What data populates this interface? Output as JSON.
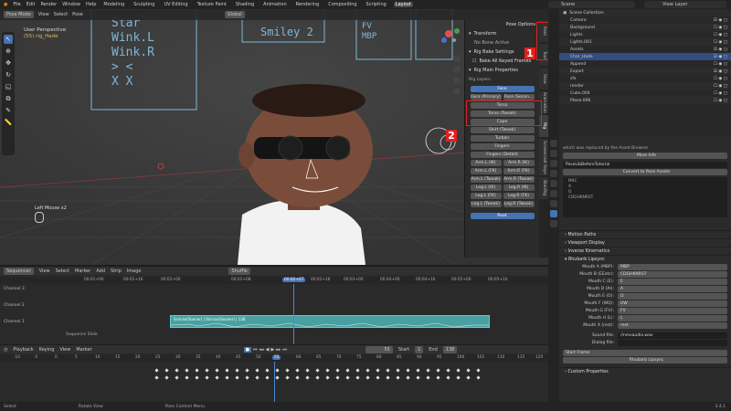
{
  "topbar": {
    "menus": [
      "File",
      "Edit",
      "Render",
      "Window",
      "Help"
    ],
    "workspaces": [
      "Layout",
      "Modeling",
      "Sculpting",
      "UV Editing",
      "Texture Paint",
      "Shading",
      "Animation",
      "Rendering",
      "Compositing",
      "Scripting",
      "Layout"
    ],
    "active_workspace_index": 10,
    "scene": "Scene",
    "view_layer": "View Layer"
  },
  "viewport": {
    "mode": "Pose Mode",
    "menus": [
      "View",
      "Select",
      "Pose"
    ],
    "orientation": "Global",
    "info_line1": "User Perspective",
    "info_line2": "(55) rig_Hade",
    "hotkey_hint": "Left Mouse x2",
    "board_text_left": [
      "Star",
      "Wink.L",
      "Wink.R",
      "> <",
      "X X"
    ],
    "board_text_mid": "Smiley 2",
    "board_text_right": [
      "FV",
      "MBP"
    ]
  },
  "npanel": {
    "options_label": "Pose Options",
    "transform": "Transform",
    "bone_active": "No Bone Active",
    "bake_title": "Rig Bake Settings",
    "bake_btn": "Bake All Keyed Frames",
    "main_props": "Rig Main Properties",
    "layers_label": "Rig Layers",
    "buttons": [
      {
        "label": "Face",
        "style": "blue"
      },
      {
        "label": "Face (Primary)",
        "label2": "Face (Secon..."
      },
      {
        "label": "Torso"
      },
      {
        "label": "Torso (Tweak)"
      },
      {
        "label": "Cape"
      },
      {
        "label": "Shirt (Tweak)"
      },
      {
        "label": "Turban"
      },
      {
        "label": "Fingers"
      },
      {
        "label": "Fingers (Detail)"
      },
      {
        "label": "Arm.L (IK)",
        "label2": "Arm.R (IK)"
      },
      {
        "label": "Arm.L (FK)",
        "label2": "Arm.R (FK)"
      },
      {
        "label": "Arm.L (Tweak)",
        "label2": "Arm.R (Tweak)"
      },
      {
        "label": "Leg.L (IK)",
        "label2": "Leg.R (IK)"
      },
      {
        "label": "Leg.L (FK)",
        "label2": "Leg.R (FK)"
      },
      {
        "label": "Leg.L (Tweak)",
        "label2": "Leg.R (Tweak)"
      }
    ],
    "root_btn": "Root",
    "tabs": [
      "Item",
      "Tool",
      "View",
      "Animation",
      "Rig",
      "Screencast Keys",
      "BlenRig"
    ]
  },
  "annotations": {
    "badge1": "1",
    "badge2": "2"
  },
  "outliner": {
    "title": "Scene Collection",
    "rows": [
      "Camera",
      "Background",
      "Lights",
      "Lights.001",
      "Assets",
      "Char_Hade",
      "Append",
      "Export",
      "sfx",
      "render",
      "Cube.004",
      "Plane.006"
    ]
  },
  "properties": {
    "replaced_note": "which was replaced by the Asset Browser",
    "more_info": "More Info",
    "file_name": "PoseLibBeforeTutorial",
    "convert_btn": "Convert to Pose Assets",
    "pose_list": [
      "M4C",
      "A",
      "O",
      "CDGHKNRST"
    ],
    "sections": [
      "Motion Paths",
      "Viewport Display",
      "Inverse Kinematics",
      "Rhubarb Lipsync"
    ],
    "mouth_fields": [
      {
        "label": "Mouth A (MBP):",
        "value": "MBP"
      },
      {
        "label": "Mouth B (EEetc):",
        "value": "CDGHKNRST"
      },
      {
        "label": "Mouth C (E):",
        "value": "E"
      },
      {
        "label": "Mouth D (AI):",
        "value": "A"
      },
      {
        "label": "Mouth E (O):",
        "value": "O"
      },
      {
        "label": "Mouth F (WQ):",
        "value": "UW"
      },
      {
        "label": "Mouth G (FV):",
        "value": "FV"
      },
      {
        "label": "Mouth H (L):",
        "value": "L"
      },
      {
        "label": "Mouth X (rest):",
        "value": "rest"
      }
    ],
    "sound_label": "Sound file:",
    "sound_value": "//nmsaudio.wav",
    "dialog_label": "Dialog file:",
    "start_frame": "Start Frame",
    "rhubarb_btn": "Rhubarb Lipsync",
    "custom_props": "Custom Properties",
    "version": "3.4.1"
  },
  "sequencer": {
    "menus": [
      "Sequencer",
      "View",
      "Select",
      "Marker",
      "Add",
      "Strip",
      "Image"
    ],
    "shuffle": "Shuffle",
    "timecodes": [
      "00:01+00",
      "00:01+16",
      "00:02+00",
      "00:01+08",
      "00:02+07",
      "00:02+16",
      "00:03+00",
      "00:03+16",
      "00:04+00",
      "00:04+16",
      "00:05+00",
      "00:05+16"
    ],
    "current_time": "00:02+07",
    "channels": [
      "Channel 3",
      "Channel 2",
      "Channel 1"
    ],
    "strip_label": "Ssirvas(Sooner) | Ssirvas(Sooner) | 138",
    "sidebar_label": "Sequence Slide"
  },
  "timeline": {
    "menus": [
      "Playback",
      "Keying",
      "View",
      "Marker"
    ],
    "current_frame": "55",
    "start_label": "Start",
    "start_value": "1",
    "end_label": "End",
    "end_value": "138",
    "frame_ticks": [
      "-10",
      "-5",
      "0",
      "5",
      "10",
      "15",
      "20",
      "25",
      "30",
      "35",
      "40",
      "45",
      "50",
      "55",
      "60",
      "65",
      "70",
      "75",
      "80",
      "85",
      "90",
      "95",
      "100",
      "105",
      "110",
      "115",
      "120"
    ]
  },
  "statusbar": {
    "items": [
      "Select",
      "Rotate View",
      "Pose Context Menu"
    ],
    "version": "3.4.1"
  },
  "colors": {
    "accent": "#4772b3",
    "strip": "#4aa0a0",
    "annotation": "#e02020"
  }
}
